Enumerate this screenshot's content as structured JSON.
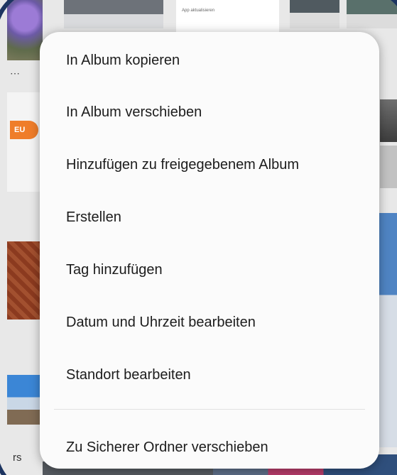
{
  "background": {
    "badge_label": "EU",
    "overflow_dots": "⋯",
    "partial_label": "rs",
    "mini_text": "App aktualisieren"
  },
  "menu": {
    "items": [
      {
        "label": "In Album kopieren"
      },
      {
        "label": "In Album verschieben"
      },
      {
        "label": "Hinzufügen zu freigegebenem Album"
      },
      {
        "label": "Erstellen"
      },
      {
        "label": "Tag hinzufügen"
      },
      {
        "label": "Datum und Uhrzeit bearbeiten"
      },
      {
        "label": "Standort bearbeiten"
      },
      {
        "label": "Zu Sicherer Ordner verschieben"
      }
    ]
  },
  "colors": {
    "menu_background": "#fbfbfb",
    "badge": "#ef7d2a",
    "bezel": "#1d3561"
  }
}
